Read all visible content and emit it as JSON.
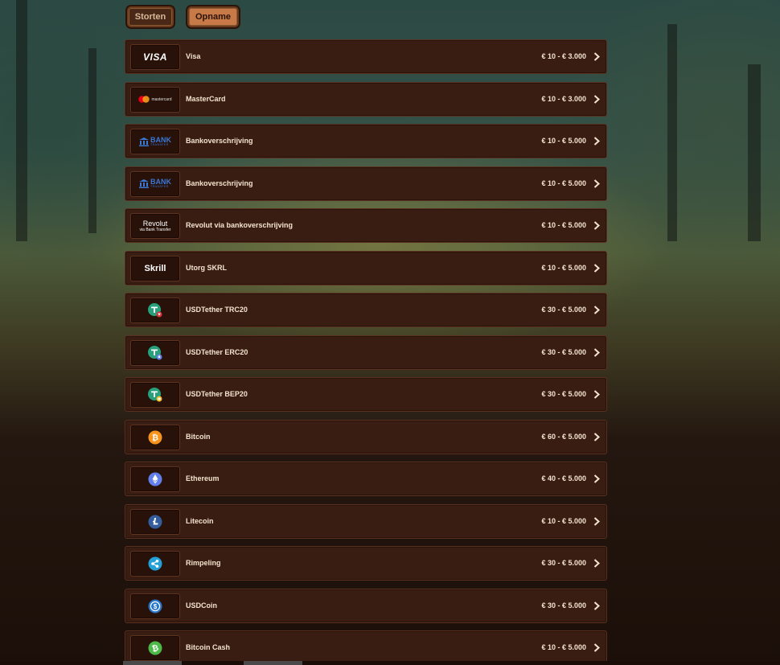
{
  "tabs": {
    "deposit_label": "Storten",
    "withdraw_label": "Opname",
    "active": "Opname"
  },
  "logo_text": {
    "visa": "VISA",
    "mastercard": "mastercard",
    "bank_title": "BANK",
    "bank_sub": "TRANSFER",
    "revolut_title": "Revolut",
    "revolut_sub": "via Bank Transfer",
    "skrill": "Skrill"
  },
  "methods": [
    {
      "name": "Visa",
      "range": "€ 10 - € 3.000",
      "icon": "visa-logo-icon"
    },
    {
      "name": "MasterCard",
      "range": "€ 10 - € 3.000",
      "icon": "mastercard-logo-icon"
    },
    {
      "name": "Bankoverschrijving",
      "range": "€ 10 - € 5.000",
      "icon": "bank-transfer-logo-icon"
    },
    {
      "name": "Bankoverschrijving",
      "range": "€ 10 - € 5.000",
      "icon": "bank-transfer-logo-icon"
    },
    {
      "name": "Revolut via bankoverschrijving",
      "range": "€ 10 - € 5.000",
      "icon": "revolut-logo-icon"
    },
    {
      "name": "Utorg SKRL",
      "range": "€ 10 - € 5.000",
      "icon": "skrill-logo-icon"
    },
    {
      "name": "USDTether TRC20",
      "range": "€ 30 - € 5.000",
      "icon": "tether-trc20-icon"
    },
    {
      "name": "USDTether ERC20",
      "range": "€ 30 - € 5.000",
      "icon": "tether-erc20-icon"
    },
    {
      "name": "USDTether BEP20",
      "range": "€ 30 - € 5.000",
      "icon": "tether-bep20-icon"
    },
    {
      "name": "Bitcoin",
      "range": "€ 60 - € 5.000",
      "icon": "bitcoin-icon"
    },
    {
      "name": "Ethereum",
      "range": "€ 40 - € 5.000",
      "icon": "ethereum-icon"
    },
    {
      "name": "Litecoin",
      "range": "€ 10 - € 5.000",
      "icon": "litecoin-icon"
    },
    {
      "name": "Rimpeling",
      "range": "€ 30 - € 5.000",
      "icon": "ripple-icon"
    },
    {
      "name": "USDCoin",
      "range": "€ 30 - € 5.000",
      "icon": "usdcoin-icon"
    },
    {
      "name": "Bitcoin Cash",
      "range": "€ 10 - € 5.000",
      "icon": "bitcoin-cash-icon"
    }
  ],
  "colors": {
    "row_bg": "#3a1d12",
    "active_tab": "#c77a48",
    "tether": "#26a17b",
    "bitcoin": "#f7931a",
    "ethereum": "#627eea",
    "litecoin": "#345d9d",
    "ripple": "#23a0d8",
    "usdcoin": "#2775ca",
    "bitcoin_cash": "#4cb848"
  }
}
